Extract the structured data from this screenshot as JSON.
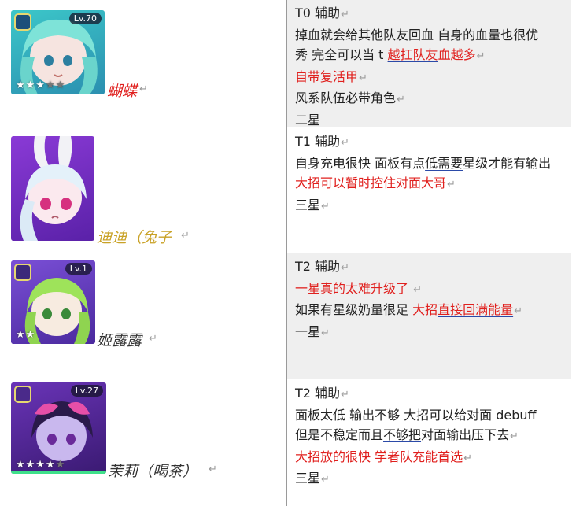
{
  "rows": [
    {
      "name": "蝴蝶",
      "level": "Lv.70",
      "stars_on": 3,
      "stars_total": 5,
      "tier": "T0 辅助",
      "star_req": "二星",
      "colors": {
        "name": "#e0201e",
        "card_bg": "#2ea8b8",
        "hair": "#7ee3d8"
      }
    },
    {
      "name": "迪迪（兔子",
      "level": "",
      "stars_on": 0,
      "stars_total": 0,
      "tier": "T1 辅助",
      "star_req": "三星",
      "colors": {
        "name": "#c9a227",
        "card_bg": "#7a2fc9",
        "hair": "#e4f1fa"
      }
    },
    {
      "name": "姬露露",
      "level": "Lv.1",
      "stars_on": 2,
      "stars_total": 5,
      "tier": "T2 辅助",
      "star_req": "一星",
      "colors": {
        "name": "#333333",
        "card_bg": "#6a3cc2",
        "hair": "#9ee35a"
      }
    },
    {
      "name": "茉莉（喝茶）",
      "level": "Lv.27",
      "stars_on": 4,
      "stars_total": 5,
      "tier": "T2 辅助",
      "star_req": "三星",
      "colors": {
        "name": "#333333",
        "card_bg": "#5a2a9a",
        "hair": "#e64fa8"
      }
    }
  ],
  "text": {
    "r0_l1_a": "掉血就",
    "r0_l1_b": "会给其他队友回血  自身的血量也很优",
    "r0_l2_a": "秀  完全可以当 t  ",
    "r0_l2_b": "越扛队友",
    "r0_l2_c": "血越多",
    "r0_l3": "自带复活甲",
    "r0_l4": "风系队伍必带角色",
    "r1_l1_a": "自身充电很快  面板有点",
    "r1_l1_b": "低需要",
    "r1_l1_c": "星级才能有输出",
    "r1_l2": "大招可以暂时控住对面大哥",
    "r2_l1": "一星真的太难升级了 ",
    "r2_l2_a": "如果有星级奶量很足  ",
    "r2_l2_b": "大招",
    "r2_l2_c": "直接回满能量",
    "r3_l1": "面板太低  输出不够  大招可以给对面  debuff",
    "r3_l2_a": "但是不稳定而且",
    "r3_l2_b": "不够把",
    "r3_l2_c": "对面输出压下去",
    "r3_l3": "大招放的很快  学者队充能首选"
  },
  "marks": {
    "para": "↵"
  }
}
